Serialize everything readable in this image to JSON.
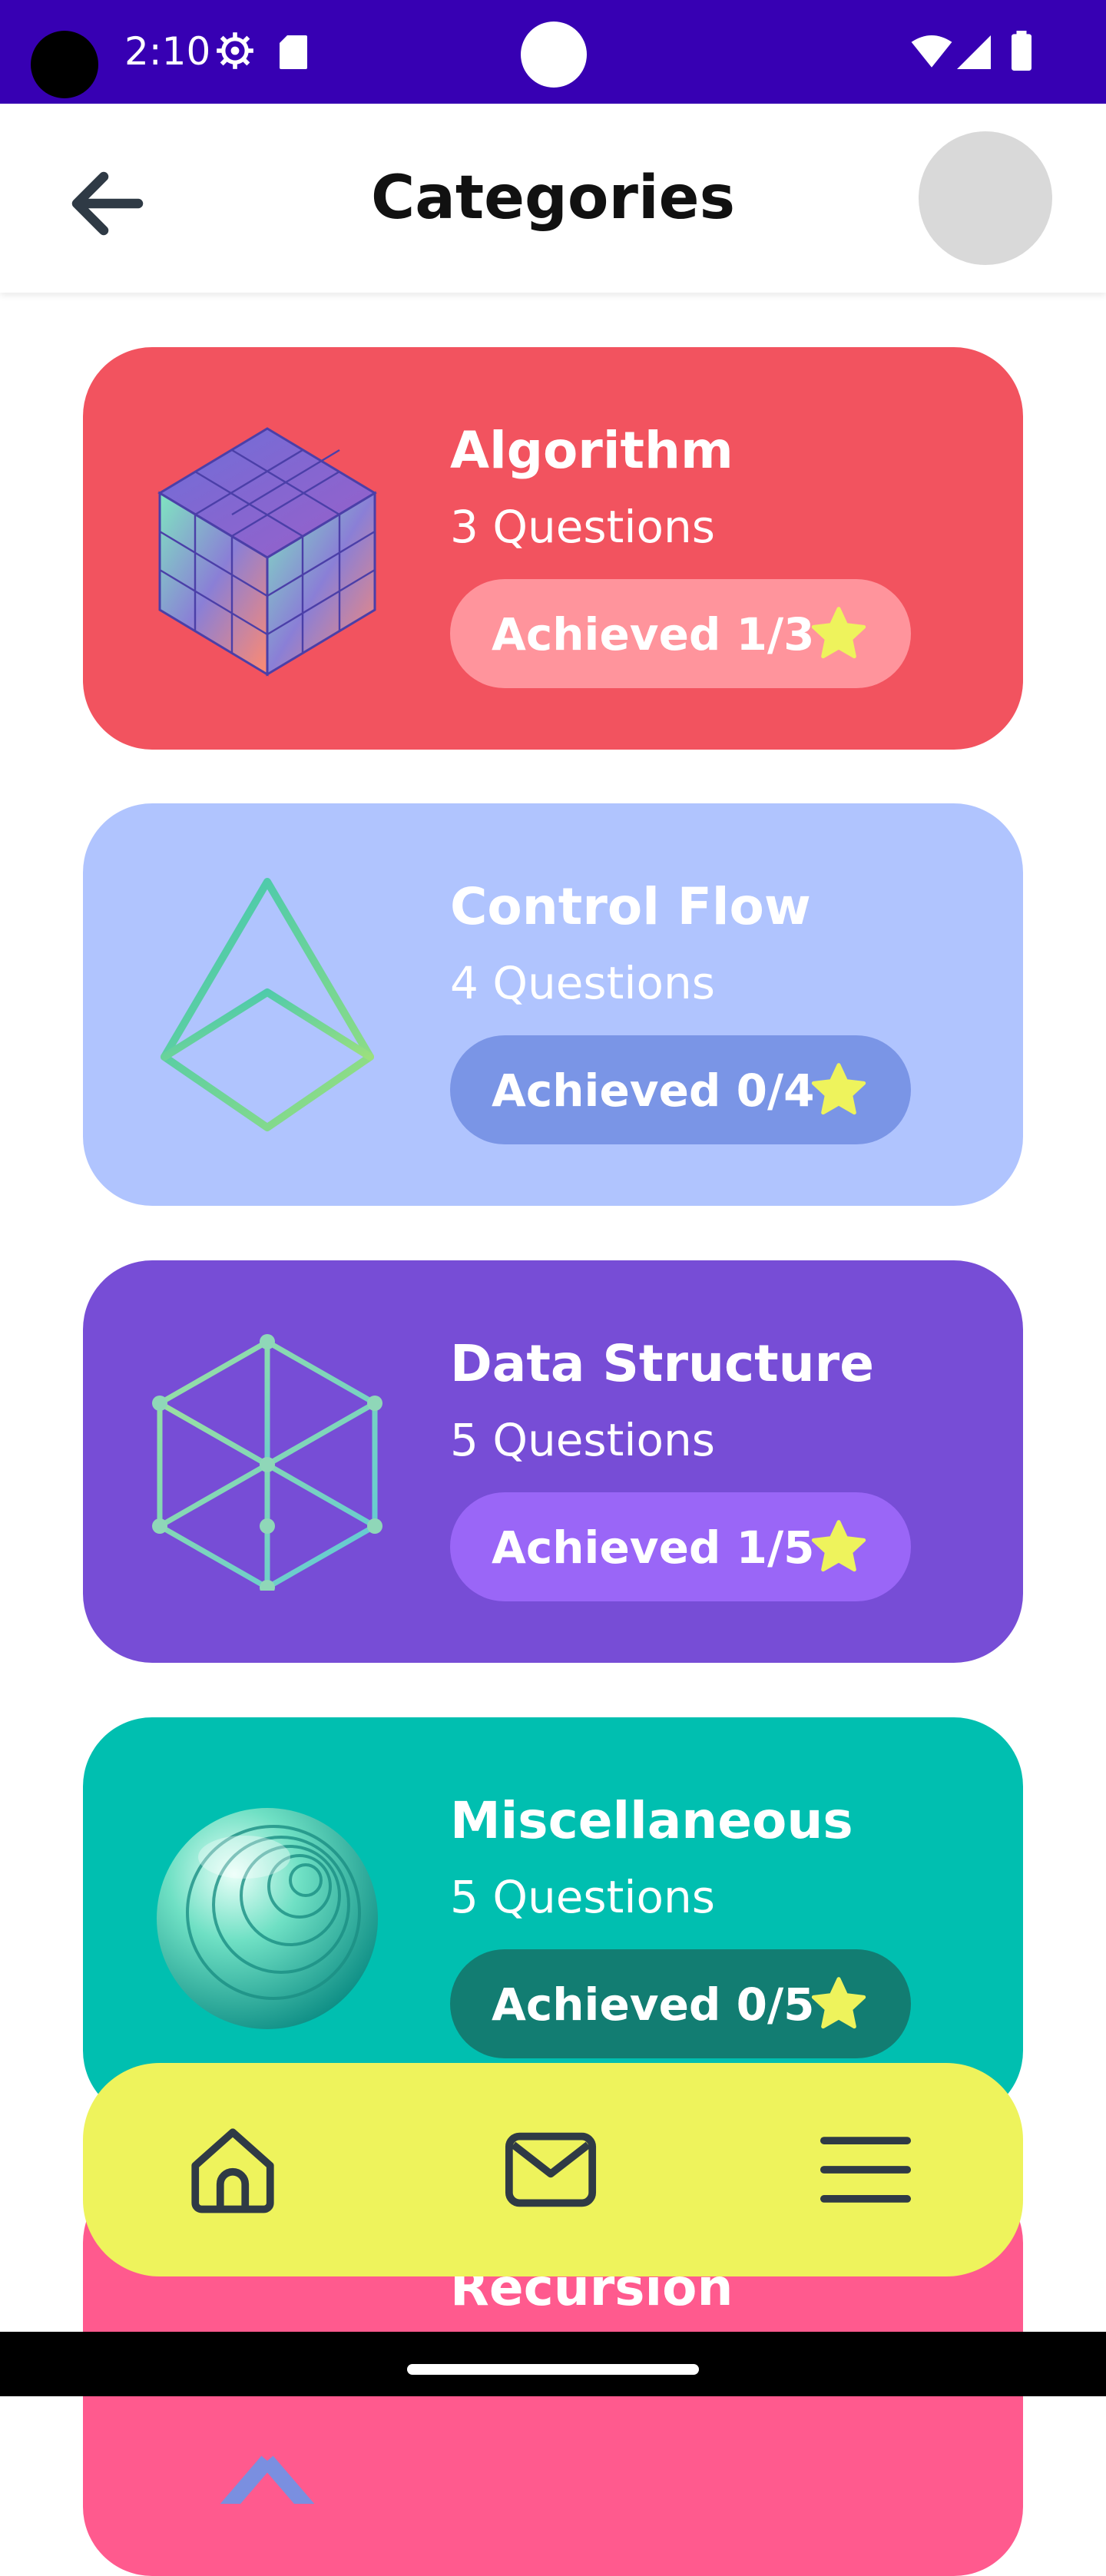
{
  "status_bar": {
    "time": "2:10",
    "background": "#3700b3",
    "icons": [
      "gear-icon",
      "sd-card-icon",
      "wifi-icon",
      "signal-icon",
      "battery-icon"
    ]
  },
  "header": {
    "title": "Categories",
    "back_icon": "arrow-left-icon"
  },
  "categories": [
    {
      "title": "Algorithm",
      "count": "3 Questions",
      "achieved": "Achieved 1/3",
      "icon": "cube-icon",
      "card_color": "#f2535f",
      "pill_color": "#ff949c"
    },
    {
      "title": "Control Flow",
      "count": "4 Questions",
      "achieved": "Achieved 0/4",
      "icon": "pyramid-icon",
      "card_color": "#b0c4fe",
      "pill_color": "#7a95e6"
    },
    {
      "title": "Data Structure",
      "count": "5 Questions",
      "achieved": "Achieved 1/5",
      "icon": "wireframe-cube-icon",
      "card_color": "#774dd6",
      "pill_color": "#9a66f7"
    },
    {
      "title": "Miscellaneous",
      "count": "5 Questions",
      "achieved": "Achieved 0/5",
      "icon": "sphere-icon",
      "card_color": "#00bfb0",
      "pill_color": "#127d72"
    },
    {
      "title": "Recursion",
      "icon": "diamond-icon",
      "card_color": "#ff5a8e"
    }
  ],
  "bottom_nav": {
    "items": [
      "home-icon",
      "mail-icon",
      "menu-icon"
    ],
    "background": "#eef35c"
  },
  "accent_star_color": "#eef35c"
}
